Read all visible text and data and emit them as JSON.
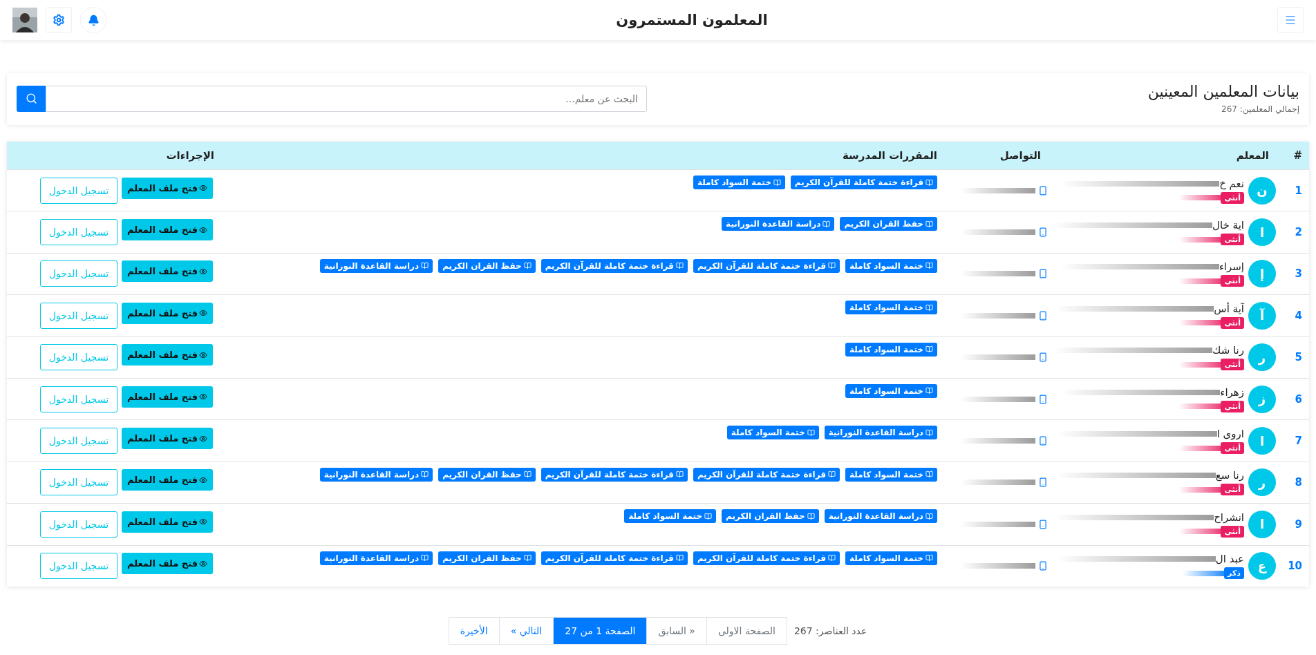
{
  "header": {
    "title": "المعلمون المستمرون"
  },
  "panel": {
    "title": "بيانات المعلمين المعينين",
    "total": "إجمالي المعلمين: 267",
    "search": {
      "placeholder": "البحث عن معلم..."
    }
  },
  "table": {
    "columns": [
      "#",
      "المعلم",
      "التواصل",
      "المقررات المدرسة",
      "الإجراءات"
    ],
    "rows": [
      {
        "index": "1",
        "initial": "ن",
        "name": "نعم خ",
        "gender": {
          "label": "أنثى",
          "color": "#e91e63"
        },
        "courses": [
          "قراءة ختمة كاملة للقرآن الكريم",
          "ختمة السواد كاملة"
        ],
        "actions": [
          "فتح ملف المعلم",
          "تسجيل الدخول"
        ]
      },
      {
        "index": "2",
        "initial": "ا",
        "name": "اية خال",
        "gender": {
          "label": "أنثى",
          "color": "#e91e63"
        },
        "courses": [
          "حفظ القران الكريم",
          "دراسة القاعدة النورانية"
        ],
        "actions": [
          "فتح ملف المعلم",
          "تسجيل الدخول"
        ]
      },
      {
        "index": "3",
        "initial": "إ",
        "name": "إسراء",
        "gender": {
          "label": "أنثى",
          "color": "#e91e63"
        },
        "courses": [
          "ختمة السواد كاملة",
          "قراءة ختمة كاملة للقرآن الكريم",
          "قراءة ختمة كاملة للقرآن الكريم",
          "حفظ القران الكريم",
          "دراسة القاعدة النورانية"
        ],
        "actions": [
          "فتح ملف المعلم",
          "تسجيل الدخول"
        ]
      },
      {
        "index": "4",
        "initial": "آ",
        "name": "آية أس",
        "gender": {
          "label": "أنثى",
          "color": "#e91e63"
        },
        "courses": [
          "ختمة السواد كاملة"
        ],
        "actions": [
          "فتح ملف المعلم",
          "تسجيل الدخول"
        ]
      },
      {
        "index": "5",
        "initial": "ر",
        "name": "رنا شك",
        "gender": {
          "label": "أنثى",
          "color": "#e91e63"
        },
        "courses": [
          "ختمة السواد كاملة"
        ],
        "actions": [
          "فتح ملف المعلم",
          "تسجيل الدخول"
        ]
      },
      {
        "index": "6",
        "initial": "ز",
        "name": "زهراء",
        "gender": {
          "label": "أنثى",
          "color": "#e91e63"
        },
        "courses": [
          "ختمة السواد كاملة"
        ],
        "actions": [
          "فتح ملف المعلم",
          "تسجيل الدخول"
        ]
      },
      {
        "index": "7",
        "initial": "ا",
        "name": "اروى ا",
        "gender": {
          "label": "أنثى",
          "color": "#e91e63"
        },
        "courses": [
          "دراسة القاعدة النورانية",
          "ختمة السواد كاملة"
        ],
        "actions": [
          "فتح ملف المعلم",
          "تسجيل الدخول"
        ]
      },
      {
        "index": "8",
        "initial": "ر",
        "name": "رنا سع",
        "gender": {
          "label": "أنثى",
          "color": "#e91e63"
        },
        "courses": [
          "ختمة السواد كاملة",
          "قراءة ختمة كاملة للقرآن الكريم",
          "قراءة ختمة كاملة للقرآن الكريم",
          "حفظ القران الكريم",
          "دراسة القاعدة النورانية"
        ],
        "actions": [
          "فتح ملف المعلم",
          "تسجيل الدخول"
        ]
      },
      {
        "index": "9",
        "initial": "ا",
        "name": "انشراح",
        "gender": {
          "label": "أنثى",
          "color": "#e91e63"
        },
        "courses": [
          "دراسة القاعدة النورانية",
          "حفظ القران الكريم",
          "ختمة السواد كاملة"
        ],
        "actions": [
          "فتح ملف المعلم",
          "تسجيل الدخول"
        ]
      },
      {
        "index": "10",
        "initial": "ع",
        "name": "عبد ال",
        "gender": {
          "label": "ذكر",
          "color": "#007bff"
        },
        "courses": [
          "ختمة السواد كاملة",
          "قراءة ختمة كاملة للقرآن الكريم",
          "قراءة ختمة كاملة للقرآن الكريم",
          "حفظ القران الكريم",
          "دراسة القاعدة النورانية"
        ],
        "actions": [
          "فتح ملف المعلم",
          "تسجيل الدخول"
        ]
      }
    ]
  },
  "pagination": {
    "count": "عدد العناصر: 267",
    "pages": [
      {
        "label": "الصفحة الاولى",
        "selected": false,
        "disabled": true
      },
      {
        "label": "« السابق",
        "selected": false,
        "disabled": true
      },
      {
        "label": "الصفحة 1 من 27",
        "selected": true,
        "disabled": false
      },
      {
        "label": "التالي »",
        "selected": false,
        "disabled": false
      },
      {
        "label": "الأخيرة",
        "selected": false,
        "disabled": false
      }
    ]
  }
}
